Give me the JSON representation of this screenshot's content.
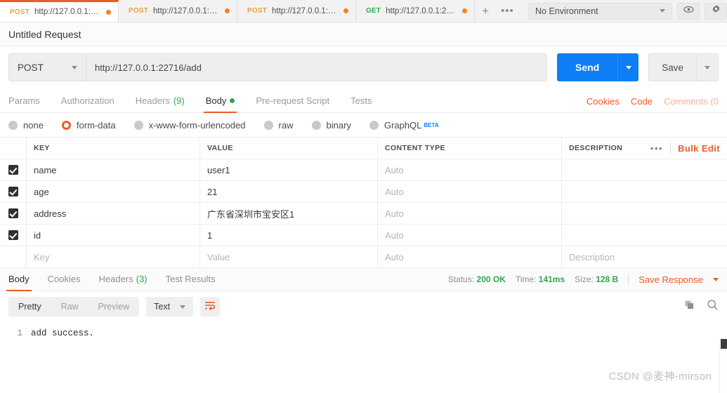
{
  "tabs": [
    {
      "method": "POST",
      "url": "http://127.0.0.1:227...",
      "active": true,
      "unsaved": true
    },
    {
      "method": "POST",
      "url": "http://127.0.0.1:227...",
      "active": false,
      "unsaved": true
    },
    {
      "method": "POST",
      "url": "http://127.0.0.1:227...",
      "active": false,
      "unsaved": true
    },
    {
      "method": "GET",
      "url": "http://127.0.0.1:2271...",
      "active": false,
      "unsaved": true
    }
  ],
  "tabstrip": {
    "new_tab_label": "+",
    "more_label": "•••",
    "environment": "No Environment",
    "eye_icon": "eye-icon",
    "gear_icon": "gear-icon"
  },
  "request": {
    "name": "Untitled Request",
    "method": "POST",
    "url": "http://127.0.0.1:22716/add",
    "send_label": "Send",
    "save_label": "Save"
  },
  "request_tabs": [
    {
      "label": "Params",
      "active": false,
      "count": "",
      "dot": false
    },
    {
      "label": "Authorization",
      "active": false,
      "count": "",
      "dot": false
    },
    {
      "label": "Headers",
      "active": false,
      "count": "(9)",
      "dot": false
    },
    {
      "label": "Body",
      "active": true,
      "count": "",
      "dot": true
    },
    {
      "label": "Pre-request Script",
      "active": false,
      "count": "",
      "dot": false
    },
    {
      "label": "Tests",
      "active": false,
      "count": "",
      "dot": false
    }
  ],
  "request_tabs_right": {
    "cookies": "Cookies",
    "code": "Code",
    "comments": "Comments (0"
  },
  "body_types": [
    {
      "label": "none",
      "selected": false,
      "beta": ""
    },
    {
      "label": "form-data",
      "selected": true,
      "beta": ""
    },
    {
      "label": "x-www-form-urlencoded",
      "selected": false,
      "beta": ""
    },
    {
      "label": "raw",
      "selected": false,
      "beta": ""
    },
    {
      "label": "binary",
      "selected": false,
      "beta": ""
    },
    {
      "label": "GraphQL",
      "selected": false,
      "beta": "BETA"
    }
  ],
  "form_table": {
    "headers": {
      "key": "KEY",
      "value": "VALUE",
      "content_type": "CONTENT TYPE",
      "description": "DESCRIPTION",
      "more": "•••",
      "bulk_edit": "Bulk Edit"
    },
    "rows": [
      {
        "checked": true,
        "key": "name",
        "value": "user1",
        "content_type": "Auto",
        "description": ""
      },
      {
        "checked": true,
        "key": "age",
        "value": "21",
        "content_type": "Auto",
        "description": ""
      },
      {
        "checked": true,
        "key": "address",
        "value": "广东省深圳市宝安区1",
        "content_type": "Auto",
        "description": ""
      },
      {
        "checked": true,
        "key": "id",
        "value": "1",
        "content_type": "Auto",
        "description": ""
      }
    ],
    "placeholder_row": {
      "key": "Key",
      "value": "Value",
      "content_type": "Auto",
      "description": "Description"
    }
  },
  "response_tabs": [
    {
      "label": "Body",
      "active": true,
      "count": ""
    },
    {
      "label": "Cookies",
      "active": false,
      "count": ""
    },
    {
      "label": "Headers",
      "active": false,
      "count": "(3)"
    },
    {
      "label": "Test Results",
      "active": false,
      "count": ""
    }
  ],
  "response_meta": {
    "status_label": "Status:",
    "status_value": "200 OK",
    "time_label": "Time:",
    "time_value": "141ms",
    "size_label": "Size:",
    "size_value": "128 B",
    "save_response": "Save Response"
  },
  "response_toolbar": {
    "view_modes": [
      {
        "label": "Pretty",
        "active": true
      },
      {
        "label": "Raw",
        "active": false
      },
      {
        "label": "Preview",
        "active": false
      }
    ],
    "format": "Text",
    "wrap_icon": "word-wrap-icon",
    "copy_icon": "copy-icon",
    "search_icon": "search-icon"
  },
  "response_body": {
    "lines": [
      {
        "number": "1",
        "text": "add success."
      }
    ]
  },
  "watermark": "CSDN @麦神-mirson",
  "colors": {
    "accent_orange": "#ef5b25",
    "send_blue": "#0d7ef5",
    "success_green": "#2fa84f",
    "post_yellow": "#e8a33d"
  }
}
